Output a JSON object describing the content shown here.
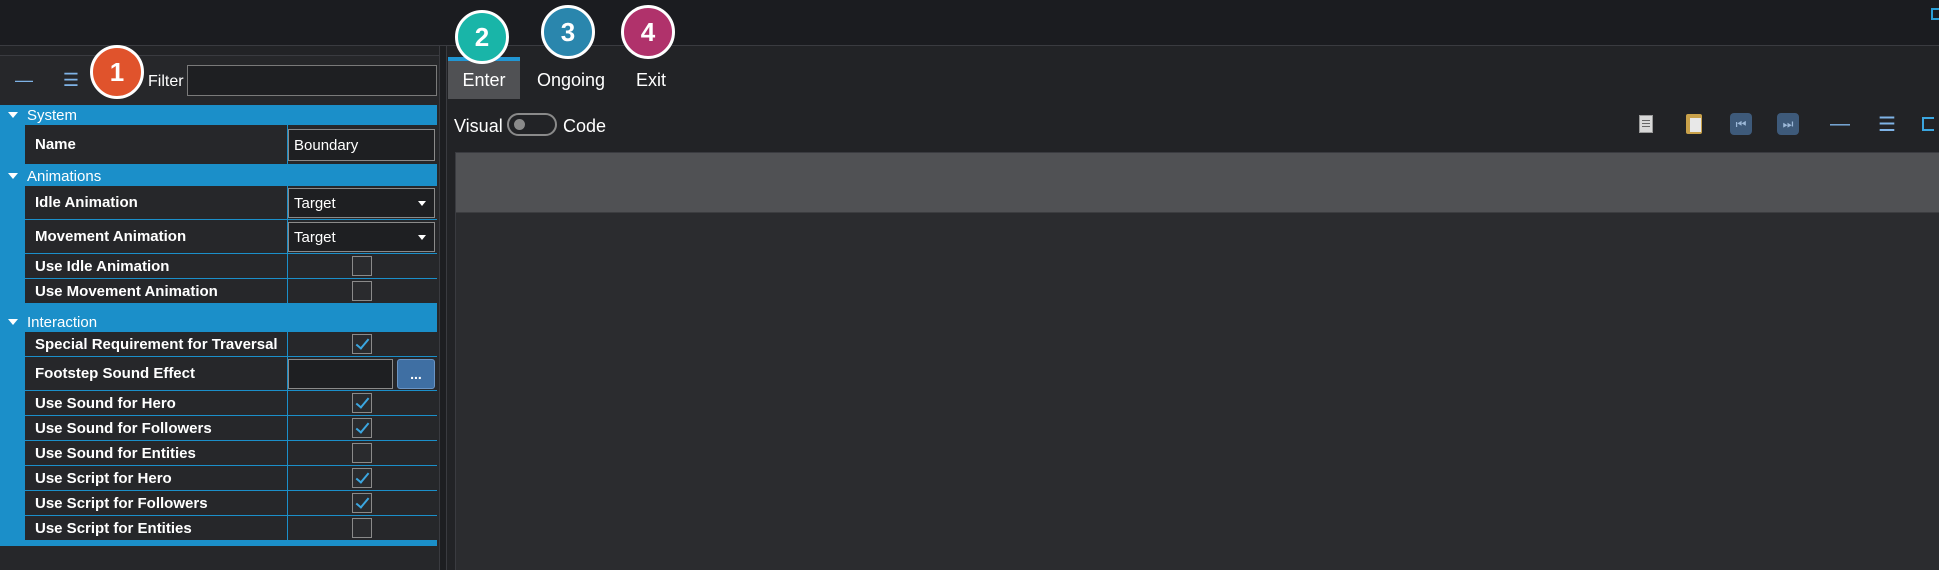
{
  "toolbar": {
    "collapse_glyph": "—",
    "list_glyph": "☰",
    "filter_label": "Filter",
    "filter_value": ""
  },
  "properties": {
    "categories": [
      {
        "label": "System",
        "rows": [
          {
            "label": "Name",
            "kind": "text",
            "value": "Boundary"
          }
        ]
      },
      {
        "label": "Animations",
        "rows": [
          {
            "label": "Idle Animation",
            "kind": "dropdown",
            "value": "Target"
          },
          {
            "label": "Movement Animation",
            "kind": "dropdown",
            "value": "Target"
          },
          {
            "label": "Use Idle Animation",
            "kind": "checkbox",
            "checked": false
          },
          {
            "label": "Use Movement Animation",
            "kind": "checkbox",
            "checked": false
          }
        ]
      },
      {
        "label": "Interaction",
        "rows": [
          {
            "label": "Special Requirement for Traversal",
            "kind": "checkbox",
            "checked": true
          },
          {
            "label": "Footstep Sound Effect",
            "kind": "file",
            "value": "",
            "browse_label": "..."
          },
          {
            "label": "Use Sound for Hero",
            "kind": "checkbox",
            "checked": true
          },
          {
            "label": "Use Sound for Followers",
            "kind": "checkbox",
            "checked": true
          },
          {
            "label": "Use Sound for Entities",
            "kind": "checkbox",
            "checked": false
          },
          {
            "label": "Use Script for Hero",
            "kind": "checkbox",
            "checked": true
          },
          {
            "label": "Use Script for Followers",
            "kind": "checkbox",
            "checked": true
          },
          {
            "label": "Use Script for Entities",
            "kind": "checkbox",
            "checked": false
          }
        ]
      }
    ]
  },
  "tabs": [
    {
      "label": "Enter",
      "active": true
    },
    {
      "label": "Ongoing",
      "active": false
    },
    {
      "label": "Exit",
      "active": false
    }
  ],
  "mode": {
    "visual_label": "Visual",
    "code_label": "Code",
    "code_enabled": false
  },
  "editor_toolbar": {
    "icons": [
      "copy-icon",
      "paste-icon",
      "first-icon",
      "last-icon",
      "collapse-icon",
      "list-icon",
      "export-icon"
    ],
    "first_glyph": "⏮",
    "last_glyph": "⏭",
    "collapse_glyph": "—",
    "list_glyph": "☰"
  },
  "callouts": [
    {
      "number": "1",
      "color": "#e0532c"
    },
    {
      "number": "2",
      "color": "#19b5a8"
    },
    {
      "number": "3",
      "color": "#2a86ad"
    },
    {
      "number": "4",
      "color": "#b0326b"
    }
  ]
}
